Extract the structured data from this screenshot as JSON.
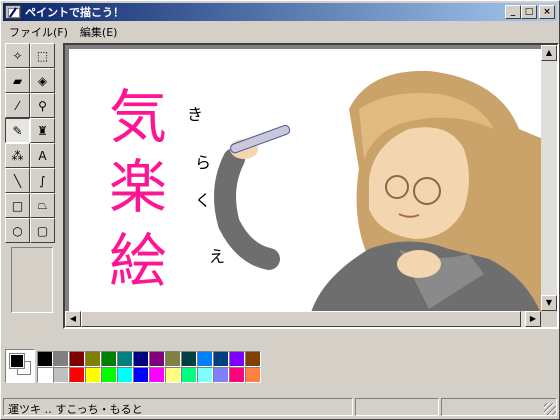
{
  "window": {
    "title": "ペイントで描こう！",
    "controls": {
      "minimize": "_",
      "maximize": "□",
      "close": "×"
    }
  },
  "menu": [
    {
      "label": "ファイル(F)"
    },
    {
      "label": "編集(E)"
    }
  ],
  "tools": [
    {
      "name": "free-select-icon",
      "glyph": "✧"
    },
    {
      "name": "rect-select-icon",
      "glyph": "⬚"
    },
    {
      "name": "eraser-icon",
      "glyph": "▰"
    },
    {
      "name": "fill-bucket-icon",
      "glyph": "◈"
    },
    {
      "name": "color-picker-icon",
      "glyph": "⁄"
    },
    {
      "name": "magnifier-icon",
      "glyph": "⚲"
    },
    {
      "name": "pencil-icon",
      "glyph": "✎"
    },
    {
      "name": "brush-icon",
      "glyph": "♜"
    },
    {
      "name": "airbrush-icon",
      "glyph": "⁂"
    },
    {
      "name": "text-icon",
      "glyph": "A"
    },
    {
      "name": "line-icon",
      "glyph": "╲"
    },
    {
      "name": "curve-icon",
      "glyph": "∫"
    },
    {
      "name": "rectangle-icon",
      "glyph": "□"
    },
    {
      "name": "polygon-icon",
      "glyph": "⏢"
    },
    {
      "name": "ellipse-icon",
      "glyph": "○"
    },
    {
      "name": "rounded-rect-icon",
      "glyph": "▢"
    }
  ],
  "active_tool": "pencil-icon",
  "canvas": {
    "calligraphy": "気楽絵",
    "furigana": [
      "き",
      "ら",
      "く",
      "え"
    ]
  },
  "colors": {
    "foreground": "#000000",
    "background": "#ffffff",
    "calligraphy": "#ff1493",
    "accent_title": "#0a246a"
  },
  "palette": [
    "#000000",
    "#808080",
    "#800000",
    "#808000",
    "#008000",
    "#008080",
    "#000080",
    "#800080",
    "#808040",
    "#004040",
    "#0080ff",
    "#004080",
    "#8000ff",
    "#804000",
    "#ffffff",
    "#c0c0c0",
    "#ff0000",
    "#ffff00",
    "#00ff00",
    "#00ffff",
    "#0000ff",
    "#ff00ff",
    "#ffff80",
    "#00ff80",
    "#80ffff",
    "#8080ff",
    "#ff0080",
    "#ff8040"
  ],
  "status": {
    "text": "運ツキ ‥ すこっち・もると"
  }
}
